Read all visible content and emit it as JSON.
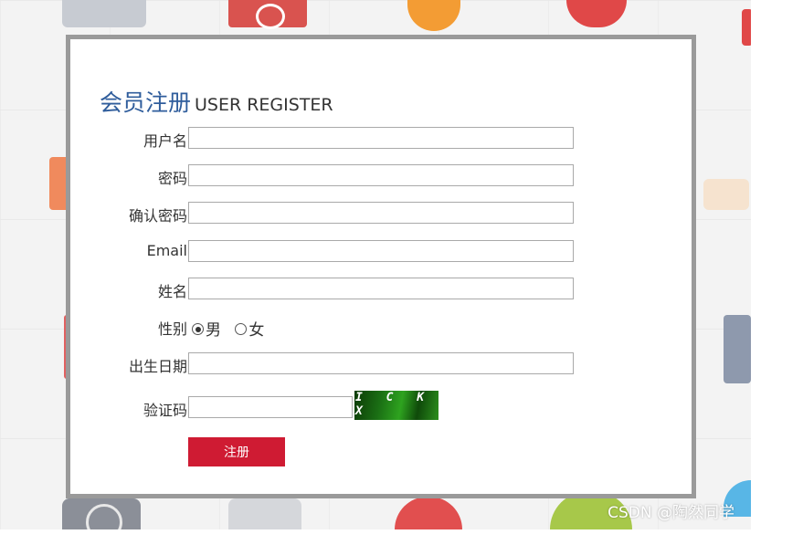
{
  "title": {
    "cn": "会员注册",
    "en": "USER REGISTER"
  },
  "fields": {
    "username": {
      "label": "用户名",
      "value": ""
    },
    "password": {
      "label": "密码",
      "value": ""
    },
    "confirm_password": {
      "label": "确认密码",
      "value": ""
    },
    "email": {
      "label": "Email",
      "value": ""
    },
    "name": {
      "label": "姓名",
      "value": ""
    },
    "gender": {
      "label": "性别",
      "options": [
        "男",
        "女"
      ],
      "selected": "男"
    },
    "birthdate": {
      "label": "出生日期",
      "value": ""
    },
    "captcha": {
      "label": "验证码",
      "value": "",
      "image_text": "I C K X"
    }
  },
  "submit_label": "注册",
  "watermark": "CSDN @陶然同学",
  "colors": {
    "title": "#2f5d9c",
    "submit_bg": "#cf1b33",
    "panel_border": "#9a9a9a"
  }
}
